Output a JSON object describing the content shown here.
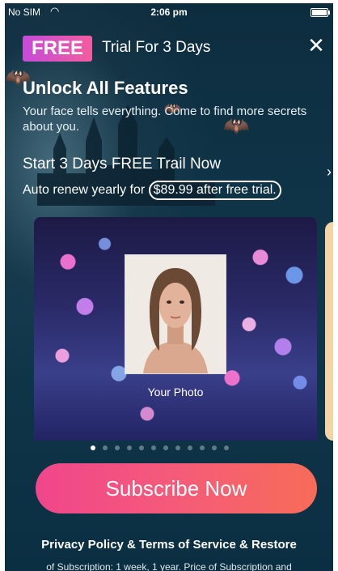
{
  "status_bar": {
    "carrier": "No SIM",
    "time": "2:06 pm"
  },
  "header": {
    "badge": "FREE",
    "trial_text": "Trial For 3 Days",
    "close_icon": "close-icon"
  },
  "promo": {
    "headline": "Unlock All Features",
    "subtitle": "Your face tells everything. Come to find more secrets about you.",
    "trial_cta": "Start 3 Days FREE Trail Now",
    "renew_prefix": "Auto renew yearly for",
    "renew_price": "$89.99 after free trial."
  },
  "carousel": {
    "photo_label": "Your Photo",
    "page_count": 12,
    "active_index": 0
  },
  "subscribe_label": "Subscribe Now",
  "footer": {
    "policy_text": "Privacy Policy & Terms of Service & Restore",
    "fineprint": "of Subscription: 1 week, 1 year. Price of Subscription and"
  },
  "colors": {
    "badge_gradient_start": "#c64bd8",
    "badge_gradient_end": "#f25da0",
    "button_gradient_start": "#f0468b",
    "button_gradient_end": "#f76c58",
    "background": "#0f3346"
  }
}
